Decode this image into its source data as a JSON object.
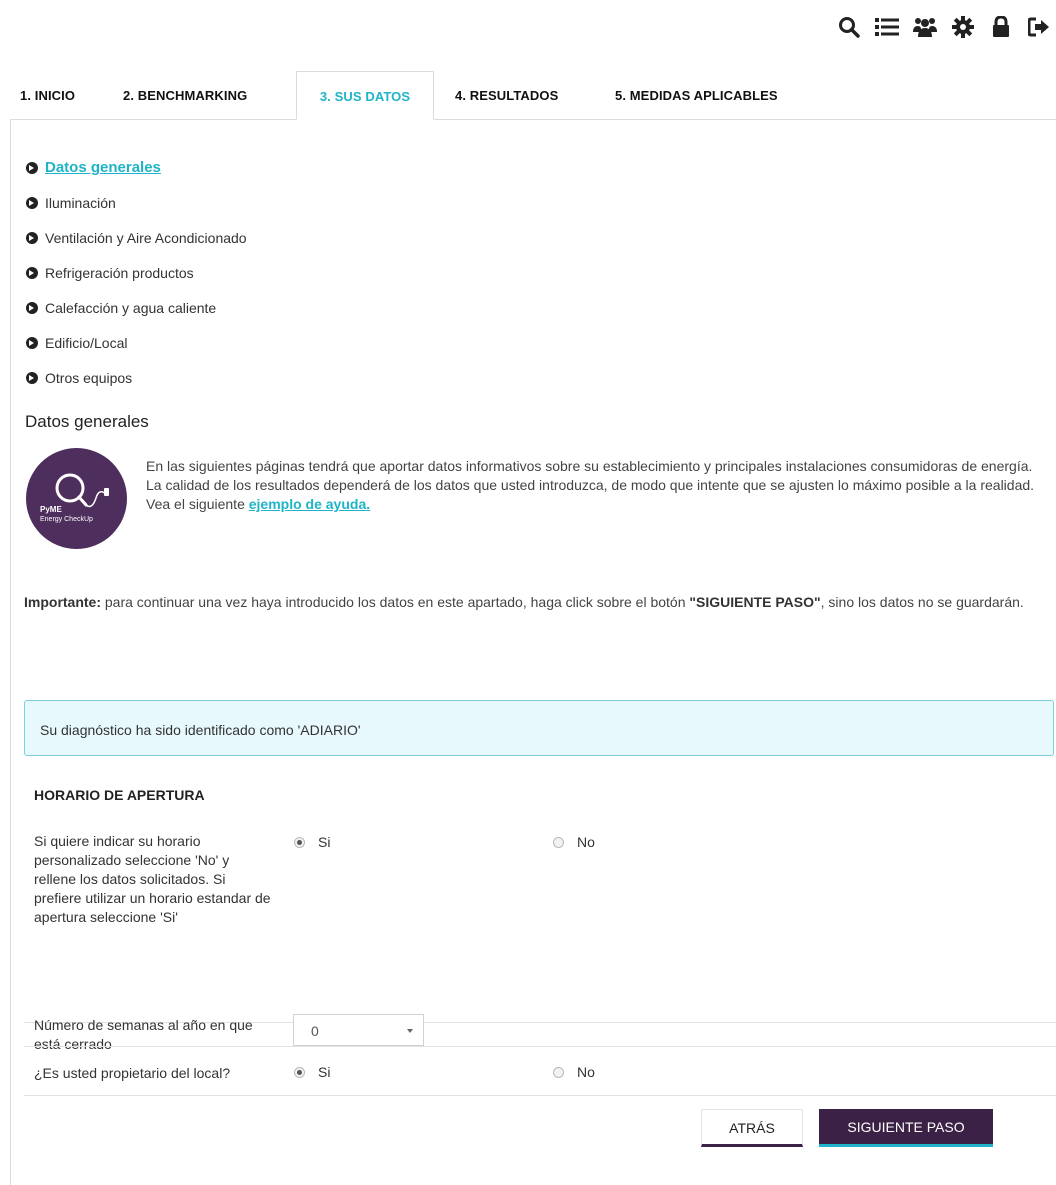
{
  "topbar": {
    "icons": [
      "search-icon",
      "list-icon",
      "users-icon",
      "gear-icon",
      "lock-icon",
      "logout-icon"
    ]
  },
  "tabs": [
    {
      "label": "1. INICIO"
    },
    {
      "label": "2. BENCHMARKING"
    },
    {
      "label": "3. SUS DATOS",
      "active": true
    },
    {
      "label": "4. RESULTADOS"
    },
    {
      "label": "5. MEDIDAS APLICABLES"
    }
  ],
  "sections": [
    {
      "label": "Datos generales",
      "active": true
    },
    {
      "label": "Iluminación"
    },
    {
      "label": "Ventilación y Aire Acondicionado"
    },
    {
      "label": "Refrigeración productos"
    },
    {
      "label": "Calefacción y agua caliente"
    },
    {
      "label": "Edificio/Local"
    },
    {
      "label": "Otros equipos"
    }
  ],
  "main": {
    "title": "Datos generales",
    "logo_text_1": "PyME",
    "logo_text_2": "Energy CheckUp",
    "intro_text": "En las siguientes páginas tendrá que aportar datos informativos sobre su establecimiento y principales instalaciones consumidoras de energía. La calidad de los resultados dependerá de los datos que usted introduzca, de modo que intente que se ajusten lo máximo posible a la realidad. Vea el siguiente ",
    "intro_link": "ejemplo de ayuda.",
    "important_label": "Importante:",
    "important_text_1": " para continuar una vez haya introducido los datos en este apartado, haga click sobre el botón ",
    "important_button_ref": "\"SIGUIENTE PASO\"",
    "important_text_2": ", sino los datos no se guardarán.",
    "alert": "Su diagnóstico ha sido identificado como 'ADIARIO'"
  },
  "form": {
    "title": "HORARIO DE APERTURA",
    "q1_label": "Si quiere indicar su horario personalizado seleccione 'No' y rellene los datos solicitados. Si prefiere utilizar un horario estandar de apertura seleccione 'Si'",
    "q1_yes": "Si",
    "q1_no": "No",
    "q1_selected": "Si",
    "q2_label": "Número de semanas al año en que está cerrado",
    "q2_value": "0",
    "q3_label": "¿Es usted propietario del local?",
    "q3_yes": "Si",
    "q3_no": "No",
    "q3_selected": "Si"
  },
  "buttons": {
    "back": "ATRÁS",
    "next": "SIGUIENTE PASO"
  },
  "colors": {
    "accent": "#1fb4c7",
    "brand": "#3a2145",
    "alert_bg": "#e7f9fc"
  }
}
